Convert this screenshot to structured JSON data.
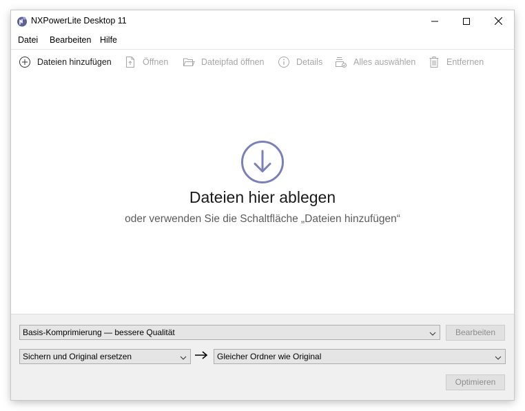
{
  "window": {
    "title": "NXPowerLite Desktop 11"
  },
  "menu": {
    "items": [
      "Datei",
      "Bearbeiten",
      "Hilfe"
    ]
  },
  "toolbar": {
    "add_files": "Dateien hinzufügen",
    "open": "Öffnen",
    "open_path": "Dateipfad öffnen",
    "details": "Details",
    "select_all": "Alles auswählen",
    "remove": "Entfernen"
  },
  "drop": {
    "title": "Dateien hier ablegen",
    "subtitle": "oder verwenden Sie die Schaltfläche „Dateien hinzufügen“"
  },
  "settings": {
    "compression_selected": "Basis-Komprimierung — bessere Qualität",
    "edit_button": "Bearbeiten",
    "file_action_selected": "Sichern und Original ersetzen",
    "destination_selected": "Gleicher Ordner wie Original",
    "optimize_button": "Optimieren"
  },
  "icons": {
    "app": "nxpowerlite-logo-icon",
    "add": "plus-circle-icon",
    "open": "document-open-icon",
    "open_path": "folder-icon",
    "details": "info-icon",
    "select_all": "select-all-icon",
    "remove": "trash-icon",
    "drop": "download-arrow-circle-icon",
    "arrow": "arrow-right-icon"
  },
  "colors": {
    "accent": "#7b80b8",
    "disabled_text": "#a6a6a6",
    "panel_bg": "#f0f0f0"
  }
}
